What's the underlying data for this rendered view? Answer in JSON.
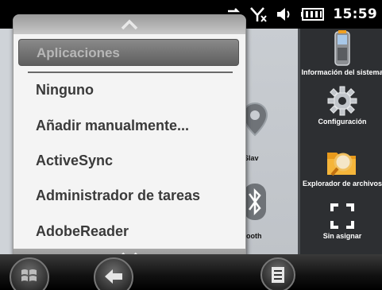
{
  "status": {
    "time": "15:59"
  },
  "launcher": {
    "partial_labels": {
      "nav": "Slav",
      "bluetooth": "etooth"
    },
    "right_tiles": [
      {
        "label": "Información del sistema",
        "icon": "device-icon"
      },
      {
        "label": "Configuración",
        "icon": "gear-icon"
      },
      {
        "label": "Explorador de archivos",
        "icon": "folder-search-icon"
      },
      {
        "label": "Sin asignar",
        "icon": "unassigned-icon"
      }
    ]
  },
  "dropdown": {
    "selected": "Aplicaciones",
    "items": [
      {
        "label": "Ninguno"
      },
      {
        "label": "Añadir manualmente..."
      },
      {
        "label": "ActiveSync"
      },
      {
        "label": "Administrador de tareas"
      },
      {
        "label": "AdobeReader"
      }
    ]
  },
  "colors": {
    "accent_orange": "#f0a020",
    "dark_panel": "#2d2f32",
    "popup_bg": "#f4f4f4"
  }
}
